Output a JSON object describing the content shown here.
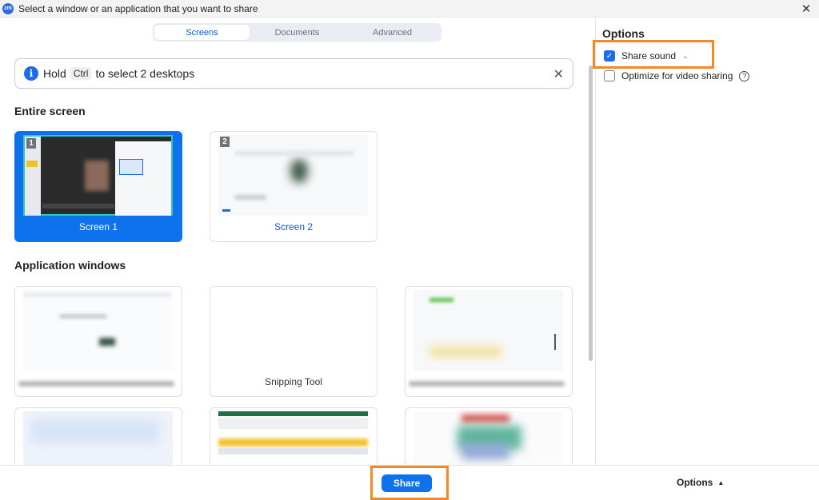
{
  "titlebar": {
    "icon": "zm",
    "title": "Select a window or an application that you want to share"
  },
  "tabs": [
    {
      "label": "Screens",
      "active": true
    },
    {
      "label": "Documents",
      "active": false
    },
    {
      "label": "Advanced",
      "active": false
    }
  ],
  "info": {
    "prefix": "Hold",
    "key": "Ctrl",
    "suffix": "to select 2 desktops"
  },
  "sections": {
    "entire_screen": "Entire screen",
    "app_windows": "Application windows"
  },
  "screens": [
    {
      "label": "Screen 1",
      "number": "1",
      "selected": true
    },
    {
      "label": "Screen 2",
      "number": "2",
      "selected": false
    }
  ],
  "apps": [
    {
      "label": ""
    },
    {
      "label": "Snipping Tool"
    },
    {
      "label": ""
    },
    {
      "label": ""
    },
    {
      "label": ""
    },
    {
      "label": ""
    }
  ],
  "options": {
    "title": "Options",
    "share_sound": {
      "label": "Share sound",
      "checked": true
    },
    "optimize": {
      "label": "Optimize for video sharing",
      "checked": false
    }
  },
  "footer": {
    "share_label": "Share",
    "options_label": "Options"
  },
  "colors": {
    "accent": "#0e72ed",
    "highlight": "#f08a24"
  }
}
